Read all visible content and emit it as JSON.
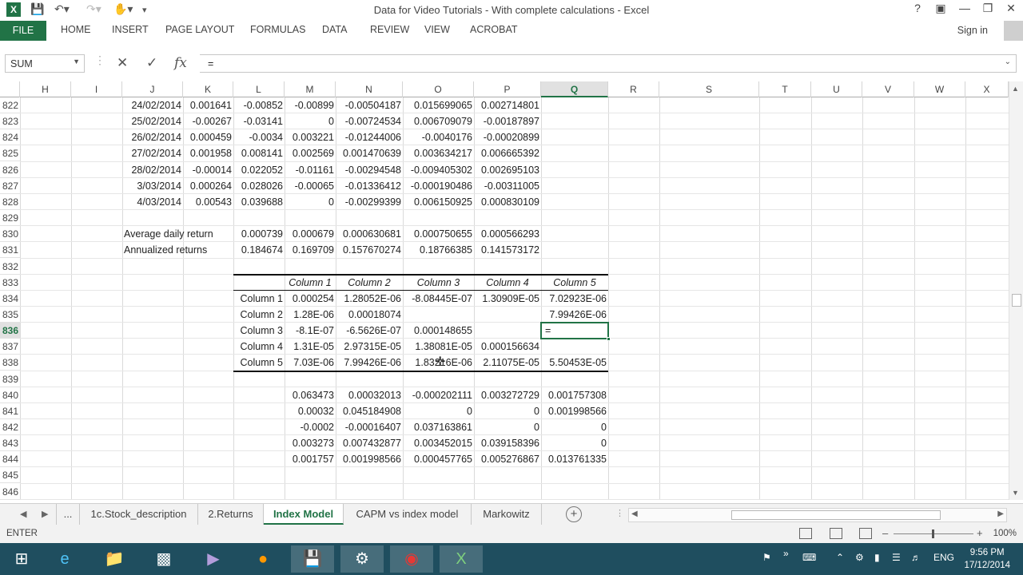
{
  "window": {
    "title": "Data for Video Tutorials - With complete calculations - Excel",
    "app_icon": "X",
    "controls": [
      "?",
      "ribbon-display-icon",
      "minimize-icon",
      "restore-icon",
      "close-icon"
    ]
  },
  "ribbon": {
    "file": "FILE",
    "tabs": [
      "HOME",
      "INSERT",
      "PAGE LAYOUT",
      "FORMULAS",
      "DATA",
      "REVIEW",
      "VIEW",
      "ACROBAT"
    ],
    "sign_in": "Sign in"
  },
  "formula_bar": {
    "name_box": "SUM",
    "formula": "="
  },
  "columns": [
    "H",
    "I",
    "J",
    "K",
    "L",
    "M",
    "N",
    "O",
    "P",
    "Q",
    "R",
    "S",
    "T",
    "U",
    "V",
    "W",
    "X"
  ],
  "selected_column": "Q",
  "rows": [
    "822",
    "823",
    "824",
    "825",
    "826",
    "827",
    "828",
    "829",
    "830",
    "831",
    "832",
    "833",
    "834",
    "835",
    "836",
    "837",
    "838",
    "839",
    "840",
    "841",
    "842",
    "843",
    "844",
    "845",
    "846"
  ],
  "selected_row": "836",
  "data_rows": [
    [
      "24/02/2014",
      "0.001641",
      "-0.00852",
      "-0.00899",
      "-0.00504187",
      "0.015699065",
      "0.002714801"
    ],
    [
      "25/02/2014",
      "-0.00267",
      "-0.03141",
      "0",
      "-0.00724534",
      "0.006709079",
      "-0.00187897"
    ],
    [
      "26/02/2014",
      "0.000459",
      "-0.0034",
      "0.003221",
      "-0.01244006",
      "-0.0040176",
      "-0.00020899"
    ],
    [
      "27/02/2014",
      "0.001958",
      "0.008141",
      "0.002569",
      "0.001470639",
      "0.003634217",
      "0.006665392"
    ],
    [
      "28/02/2014",
      "-0.00014",
      "0.022052",
      "-0.01161",
      "-0.00294548",
      "-0.009405302",
      "0.002695103"
    ],
    [
      "3/03/2014",
      "0.000264",
      "0.028026",
      "-0.00065",
      "-0.01336412",
      "-0.000190486",
      "-0.00311005"
    ],
    [
      "4/03/2014",
      "0.00543",
      "0.039688",
      "0",
      "-0.00299399",
      "0.006150925",
      "0.000830109"
    ]
  ],
  "summary": [
    [
      "Average daily return",
      "0.000739",
      "0.000679",
      "0.000630681",
      "0.000750655",
      "0.000566293"
    ],
    [
      "Annualized returns",
      "0.184674",
      "0.169709",
      "0.157670274",
      "0.18766385",
      "0.141573172"
    ]
  ],
  "cov_headers": [
    "Column 1",
    "Column 2",
    "Column 3",
    "Column 4",
    "Column 5"
  ],
  "cov_rows": [
    [
      "Column 1",
      "0.000254",
      "1.28052E-06",
      "-8.08445E-07",
      "1.30909E-05",
      "7.02923E-06"
    ],
    [
      "Column 2",
      "1.28E-06",
      "0.00018074",
      "",
      "",
      "7.99426E-06"
    ],
    [
      "Column 3",
      "-8.1E-07",
      "-6.5626E-07",
      "0.000148655",
      "",
      "="
    ],
    [
      "Column 4",
      "1.31E-05",
      "2.97315E-05",
      "1.38081E-05",
      "0.000156634",
      ""
    ],
    [
      "Column 5",
      "7.03E-06",
      "7.99426E-06",
      "1.83216E-06",
      "2.11075E-05",
      "5.50453E-05"
    ]
  ],
  "matrix": [
    [
      "0.063473",
      "0.00032013",
      "-0.000202111",
      "0.003272729",
      "0.001757308"
    ],
    [
      "0.00032",
      "0.045184908",
      "0",
      "0",
      "0.001998566"
    ],
    [
      "-0.0002",
      "-0.00016407",
      "0.037163861",
      "0",
      "0"
    ],
    [
      "0.003273",
      "0.007432877",
      "0.003452015",
      "0.039158396",
      "0"
    ],
    [
      "0.001757",
      "0.001998566",
      "0.000457765",
      "0.005276867",
      "0.013761335"
    ]
  ],
  "sheets": {
    "ellipsis": "...",
    "tabs": [
      "1c.Stock_description",
      "2.Returns",
      "Index Model",
      "CAPM vs index model",
      "Markowitz"
    ],
    "active": "Index Model",
    "add": "+"
  },
  "status": {
    "mode": "ENTER",
    "zoom": "100%"
  },
  "taskbar": {
    "language": "ENG",
    "time": "9:56 PM",
    "date": "17/12/2014"
  }
}
